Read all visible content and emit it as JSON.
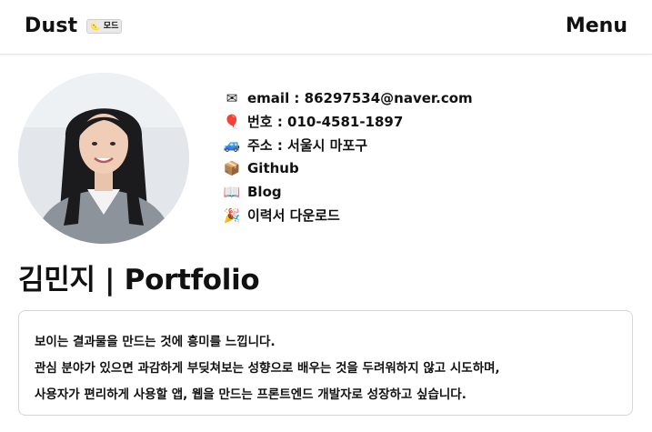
{
  "header": {
    "brand": "Dust",
    "mode_label": "모드",
    "mode_icon": "moon-icon",
    "menu_label": "Menu"
  },
  "profile": {
    "avatar": "profile-photo"
  },
  "contacts": [
    {
      "icon": "envelope-icon",
      "glyph": "✉",
      "label": "email : 86297534@naver.com"
    },
    {
      "icon": "balloon-icon",
      "glyph": "🎈",
      "label": "번호 : 010-4581-1897"
    },
    {
      "icon": "car-icon",
      "glyph": "🚙",
      "label": "주소 : 서울시 마포구"
    },
    {
      "icon": "package-icon",
      "glyph": "📦",
      "label": "Github"
    },
    {
      "icon": "book-icon",
      "glyph": "📖",
      "label": "Blog"
    },
    {
      "icon": "party-popper-icon",
      "glyph": "🎉",
      "label": "이력서 다운로드"
    }
  ],
  "title": "김민지 | Portfolio",
  "intro": [
    "보이는 결과물을 만드는 것에 흥미를 느낍니다.",
    "관심 분야가 있으면 과감하게 부딪쳐보는 성향으로 배우는 것을 두려워하지 않고 시도하며,",
    "사용자가 편리하게 사용할 앱, 웹을 만드는 프론트엔드 개발자로 성장하고 싶습니다."
  ],
  "colors": {
    "text": "#111111",
    "border": "#d6d6d6",
    "background": "#ffffff",
    "sweater": "#8c939a"
  }
}
